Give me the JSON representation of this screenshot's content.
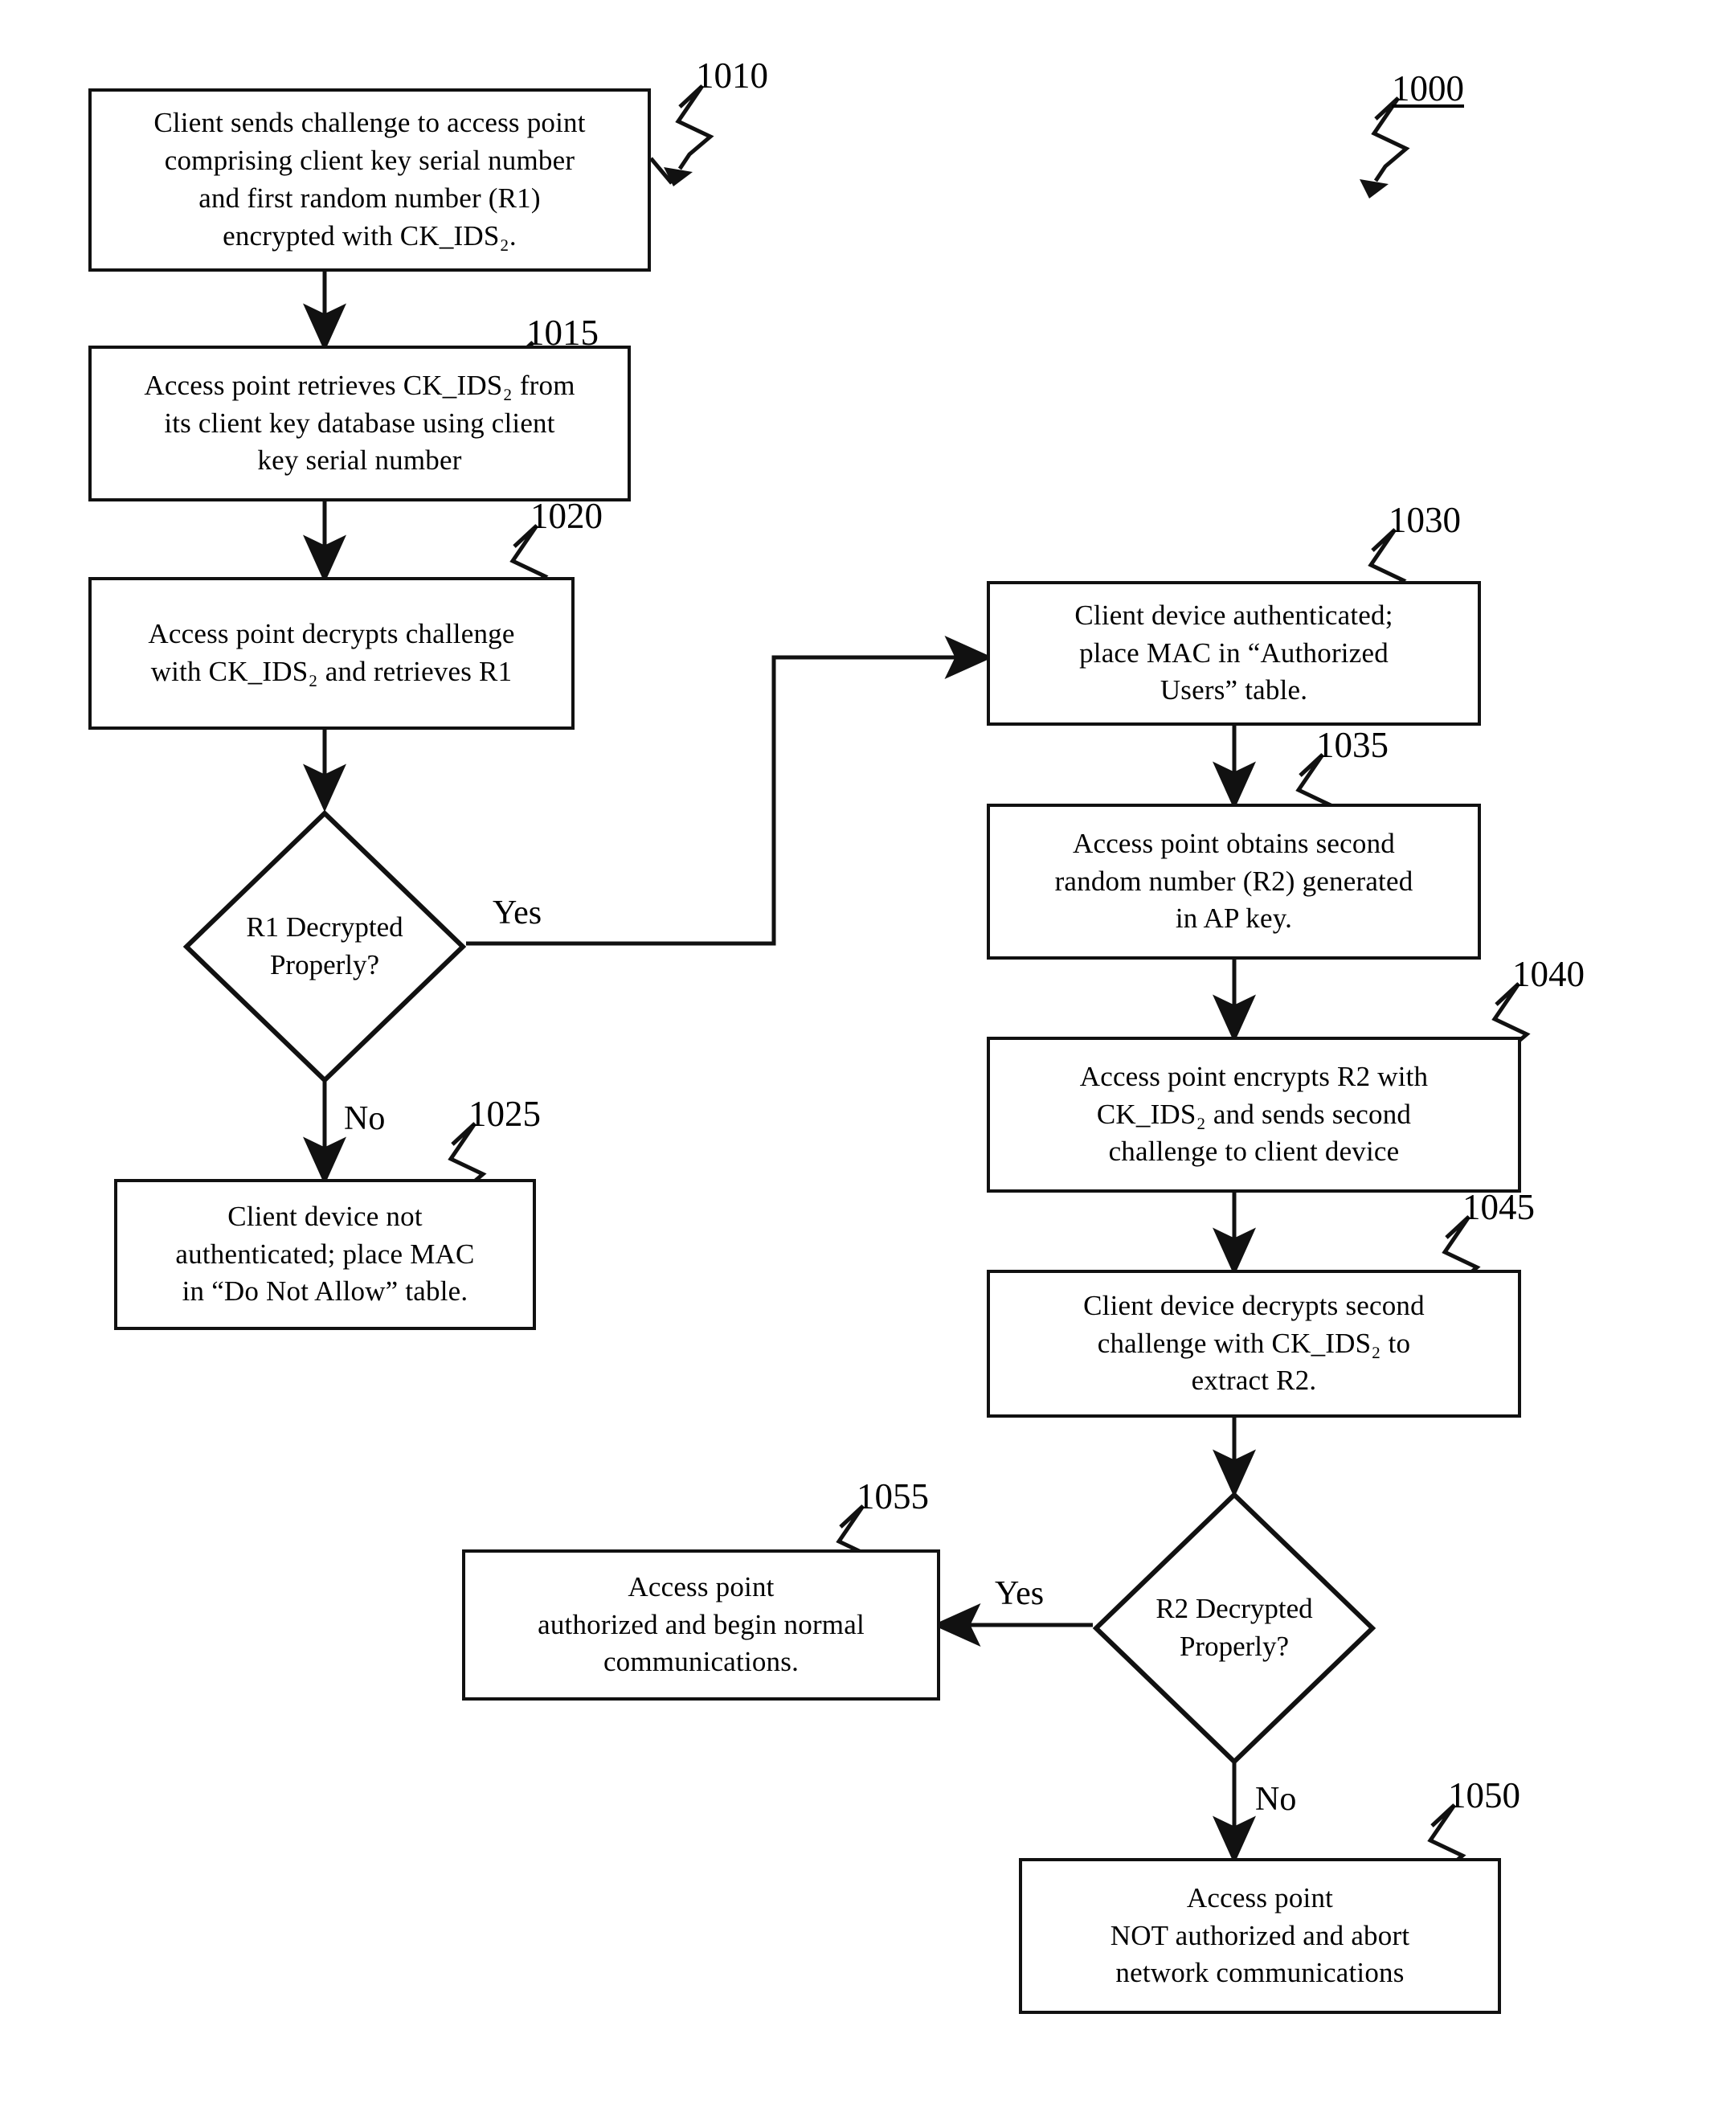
{
  "figure": {
    "number": "1000",
    "type": "flowchart"
  },
  "nodes": {
    "n1010": {
      "ref": "1010",
      "shape": "process",
      "text": "Client sends challenge to access point\ncomprising client key serial number\nand first random number (R1)\nencrypted with CK_IDS₂."
    },
    "n1015": {
      "ref": "1015",
      "shape": "process",
      "text": "Access point retrieves CK_IDS₂ from\nits client key database using client\nkey serial number"
    },
    "n1020": {
      "ref": "1020",
      "shape": "process",
      "text": "Access point decrypts challenge\nwith CK_IDS₂ and retrieves R1"
    },
    "d1": {
      "ref": "",
      "shape": "decision",
      "text": "R1 Decrypted\nProperly?"
    },
    "n1025": {
      "ref": "1025",
      "shape": "process",
      "text": "Client device not\nauthenticated; place  MAC\nin “Do Not Allow” table."
    },
    "n1030": {
      "ref": "1030",
      "shape": "process",
      "text": "Client device authenticated;\nplace MAC in “Authorized\nUsers” table."
    },
    "n1035": {
      "ref": "1035",
      "shape": "process",
      "text": "Access point obtains second\nrandom number (R2) generated\nin AP key."
    },
    "n1040": {
      "ref": "1040",
      "shape": "process",
      "text": "Access point encrypts R2 with\nCK_IDS₂ and sends second\nchallenge to client device"
    },
    "n1045": {
      "ref": "1045",
      "shape": "process",
      "text": "Client device decrypts second\nchallenge with CK_IDS₂ to\nextract R2."
    },
    "d2": {
      "ref": "",
      "shape": "decision",
      "text": "R2 Decrypted\nProperly?"
    },
    "n1055": {
      "ref": "1055",
      "shape": "process",
      "text": "Access point\nauthorized and begin normal\ncommunications."
    },
    "n1050": {
      "ref": "1050",
      "shape": "process",
      "text": "Access point\nNOT authorized and abort\nnetwork communications"
    }
  },
  "edge_labels": {
    "d1_yes": "Yes",
    "d1_no": "No",
    "d2_yes": "Yes",
    "d2_no": "No"
  },
  "colors": {
    "ink": "#111111",
    "paper": "#ffffff"
  }
}
